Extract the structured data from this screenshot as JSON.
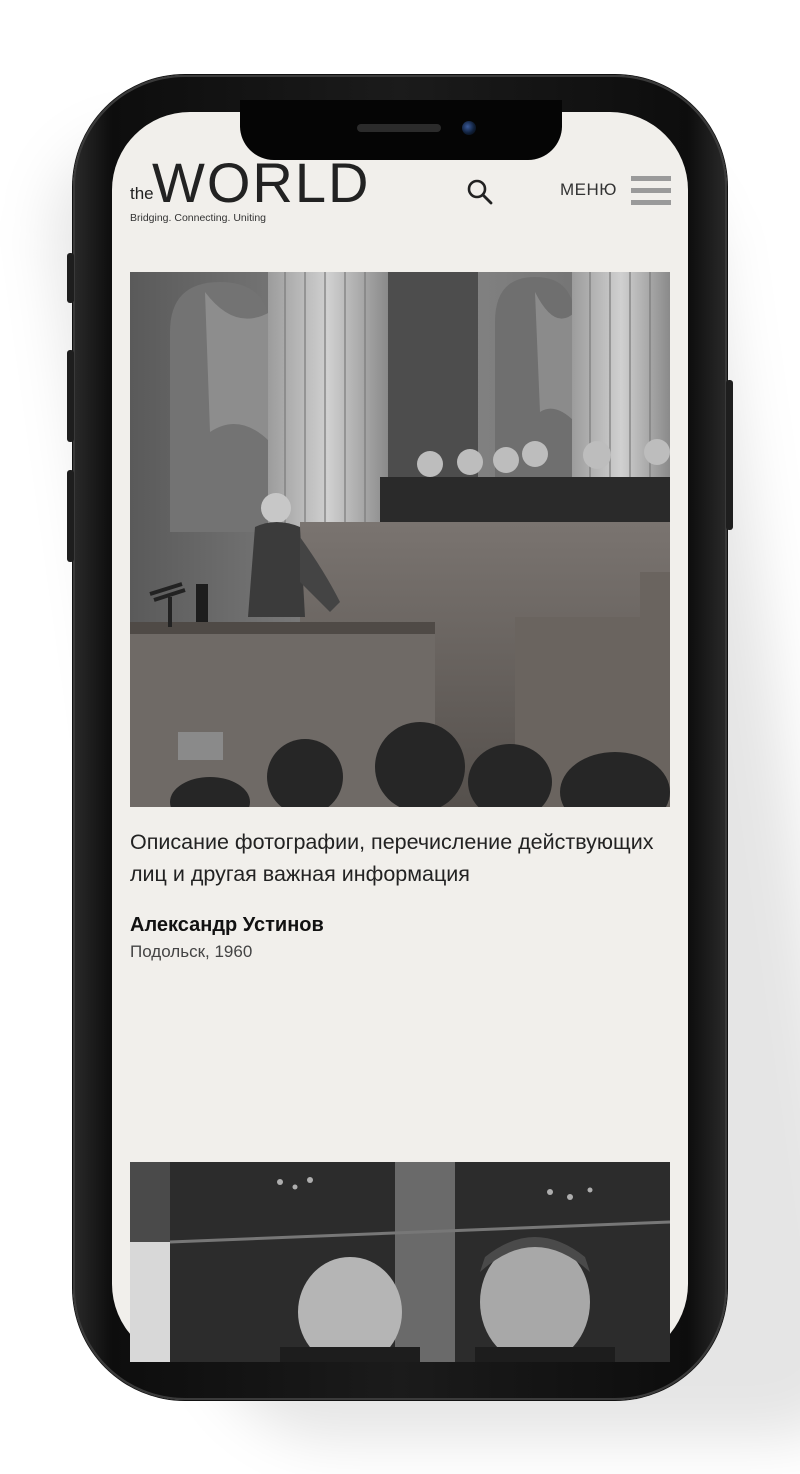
{
  "header": {
    "logo_the": "the",
    "logo_world": "WORLD",
    "logo_tagline": "Bridging. Connecting. Uniting",
    "search_icon": "search-icon",
    "menu_label": "МЕНЮ",
    "menu_icon": "hamburger-icon"
  },
  "article": {
    "photo_1_alt": "photo",
    "caption": "Описание фотографии, перечисление действующих лиц и другая важная информация",
    "author": "Александр Устинов",
    "place_date": "Подольск, 1960",
    "photo_2_alt": "photo"
  },
  "colors": {
    "screen_bg": "#f1efeb",
    "text": "#222222",
    "menu_icon": "#9a9a9a"
  }
}
